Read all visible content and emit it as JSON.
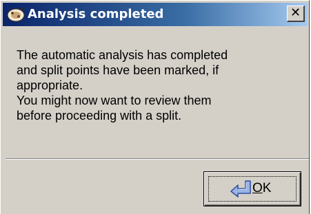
{
  "dialog": {
    "title": "Analysis completed",
    "title_icon": "app-icon",
    "close_label": "✕",
    "message_lines": [
      "The automatic analysis has completed",
      "and split points have been marked, if",
      "appropriate.",
      "You might now want to review them",
      "before proceeding with a split."
    ],
    "ok_button": {
      "mnemonic": "O",
      "rest": "K",
      "icon": "return-arrow-icon"
    }
  },
  "colors": {
    "titlebar_start": "#0a246a",
    "titlebar_end": "#a6caf0",
    "face": "#d4d0c8",
    "arrow_fill": "#9ab4e6",
    "arrow_stroke": "#2c4c9c"
  }
}
